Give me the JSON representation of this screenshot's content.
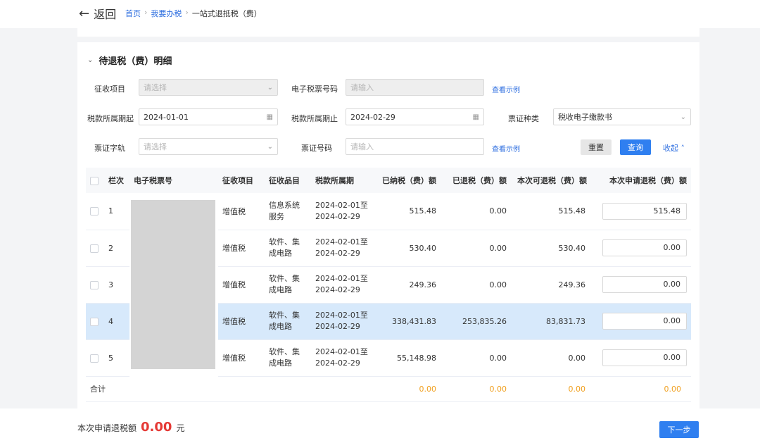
{
  "header": {
    "back_label": "返回",
    "breadcrumb": [
      "首页",
      "我要办税",
      "一站式退抵税（费）"
    ]
  },
  "section": {
    "title": "待退税（费）明细"
  },
  "filters": {
    "levy_item": {
      "label": "征收项目",
      "placeholder": "请选择"
    },
    "ticket_no": {
      "label": "电子税票号码",
      "placeholder": "请输入"
    },
    "example_link": "查看示例",
    "period_start": {
      "label": "税款所属期起",
      "value": "2024-01-01"
    },
    "period_end": {
      "label": "税款所属期止",
      "value": "2024-02-29"
    },
    "ticket_type": {
      "label": "票证种类",
      "value": "税收电子缴款书"
    },
    "ticket_word": {
      "label": "票证字轨",
      "placeholder": "请选择"
    },
    "ticket_num": {
      "label": "票证号码",
      "placeholder": "请输入"
    },
    "reset_label": "重置",
    "query_label": "查询",
    "collapse_label": "收起"
  },
  "table": {
    "headers": [
      "栏次",
      "电子税票号",
      "征收项目",
      "征收品目",
      "税款所属期",
      "已纳税（费）额",
      "已退税（费）额",
      "本次可退税（费）额",
      "本次申请退税（费）额"
    ],
    "rows": [
      {
        "idx": "1",
        "levy": "增值税",
        "item": "信息系统服务",
        "period1": "2024-02-01至",
        "period2": "2024-02-29",
        "paid": "515.48",
        "refunded": "0.00",
        "refundable": "515.48",
        "apply": "515.48"
      },
      {
        "idx": "2",
        "levy": "增值税",
        "item": "软件、集成电路",
        "period1": "2024-02-01至",
        "period2": "2024-02-29",
        "paid": "530.40",
        "refunded": "0.00",
        "refundable": "530.40",
        "apply": "0.00"
      },
      {
        "idx": "3",
        "levy": "增值税",
        "item": "软件、集成电路",
        "period1": "2024-02-01至",
        "period2": "2024-02-29",
        "paid": "249.36",
        "refunded": "0.00",
        "refundable": "249.36",
        "apply": "0.00"
      },
      {
        "idx": "4",
        "levy": "增值税",
        "item": "软件、集成电路",
        "period1": "2024-02-01至",
        "period2": "2024-02-29",
        "paid": "338,431.83",
        "refunded": "253,835.26",
        "refundable": "83,831.73",
        "apply": "0.00"
      },
      {
        "idx": "5",
        "levy": "增值税",
        "item": "软件、集成电路",
        "period1": "2024-02-01至",
        "period2": "2024-02-29",
        "paid": "55,148.98",
        "refunded": "0.00",
        "refundable": "0.00",
        "apply": "0.00"
      }
    ],
    "total": {
      "label": "合计",
      "paid": "0.00",
      "refunded": "0.00",
      "refundable": "0.00",
      "apply": "0.00"
    }
  },
  "footer": {
    "summary_label": "本次申请退税额",
    "summary_amount": "0.00",
    "summary_unit": "元",
    "next_label": "下一步"
  },
  "colors": {
    "primary": "#2f7ff0",
    "link": "#2f6fe0",
    "amount_red": "#e53935",
    "total_orange": "#f0a020",
    "row_selected": "#d7e9fb"
  }
}
